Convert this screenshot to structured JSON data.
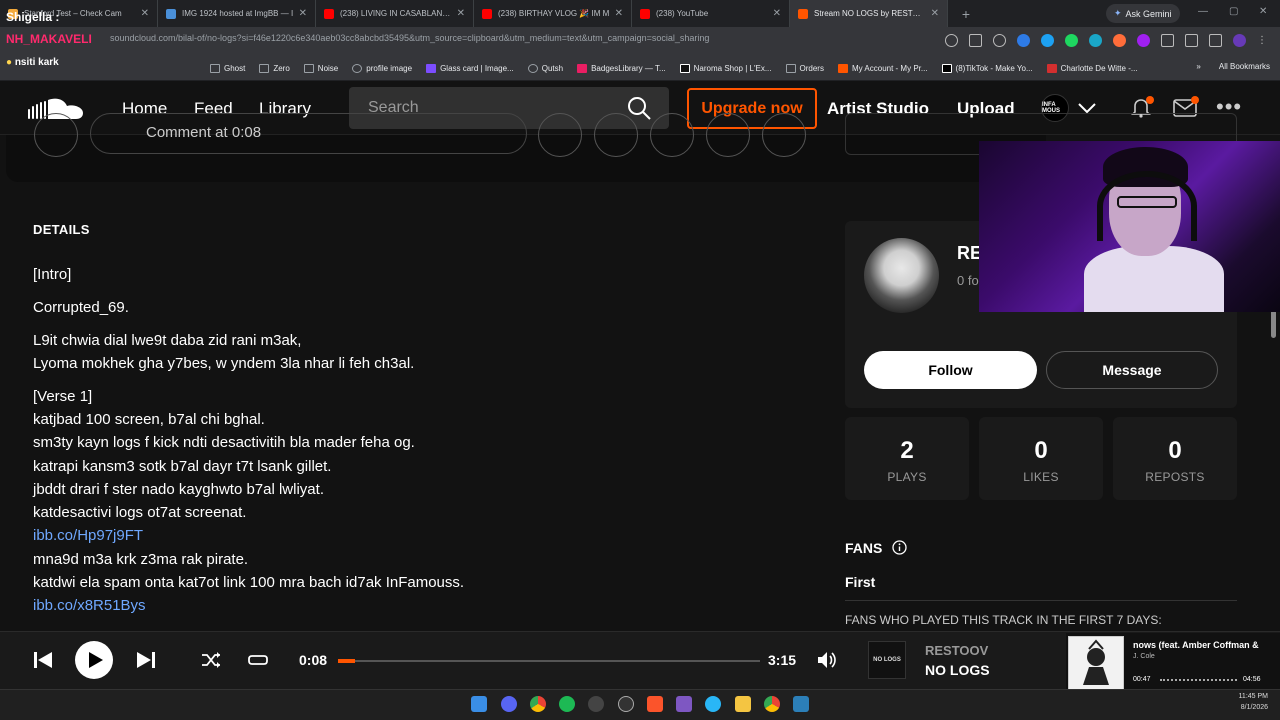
{
  "browser": {
    "tabs": [
      {
        "title": "Stanford Test – Check Cam",
        "color": "#f2a93b"
      },
      {
        "title": "IMG 1924 hosted at ImgBB — I",
        "color": "#4a90d9"
      },
      {
        "title": "(238) LIVING IN CASABLANCA",
        "color": "#ff0000"
      },
      {
        "title": "(238) BIRTHAY VLOG 🎉 IM M",
        "color": "#ff0000"
      },
      {
        "title": "(238) YouTube",
        "color": "#ff0000"
      },
      {
        "title": "Stream NO LOGS by RESTOOV",
        "color": "#ff5500"
      }
    ],
    "ask_gemini": "Ask Gemini",
    "url": "soundcloud.com/bilal-of/no-logs?si=f46e1220c6e340aeb03cc8abcbd35495&utm_source=clipboard&utm_medium=text&utm_campaign=social_sharing",
    "bookmarks": [
      "Ghost",
      "Zero",
      "Noise",
      "profile image",
      "Glass card | Image...",
      "Qutsh",
      "BadgesLibrary — T...",
      "Naroma Shop | L'Ex...",
      "Orders",
      "My Account - My Pr...",
      "(8)TikTok - Make Yo...",
      "Charlotte De Witte -..."
    ],
    "all_bookmarks": "All Bookmarks"
  },
  "overlay": {
    "streamer": "Shigella :",
    "nh": "NH_MAKAVELI",
    "red": "nsiti kark"
  },
  "header": {
    "nav": [
      "Home",
      "Feed",
      "Library"
    ],
    "search_placeholder": "Search",
    "upgrade": "Upgrade now",
    "artist_studio": "Artist Studio",
    "upload": "Upload",
    "avatar_text": "INFA MOUS"
  },
  "comment": {
    "placeholder": "Comment at 0:08"
  },
  "details": {
    "heading": "DETAILS",
    "lines": [
      {
        "text": "[Intro]",
        "link": false
      },
      {
        "text": "Corrupted_69.",
        "link": false
      },
      {
        "text": "L9it chwia dial lwe9t daba zid rani m3ak,",
        "link": false
      },
      {
        "text": "Lyoma mokhek gha y7bes, w yndem 3la nhar li feh ch3al.",
        "link": false
      },
      {
        "text": "[Verse 1]",
        "link": false
      },
      {
        "text": "katjbad 100 screen, b7al chi bghal.",
        "link": false
      },
      {
        "text": "sm3ty kayn logs f kick ndti desactivitih bla mader feha og.",
        "link": false
      },
      {
        "text": "katrapi kansm3 sotk b7al dayr t7t lsank gillet.",
        "link": false
      },
      {
        "text": "jbddt drari f ster nado kayghwto b7al lwliyat.",
        "link": false
      },
      {
        "text": "katdesactivi logs ot7at screenat.",
        "link": false
      },
      {
        "text": "ibb.co/Hp97j9FT",
        "link": true
      },
      {
        "text": "mna9d m3a krk z3ma rak pirate.",
        "link": false
      },
      {
        "text": "katdwi ela spam onta kat7ot link 100 mra bach id7ak InFamouss.",
        "link": false
      },
      {
        "text": "ibb.co/x8R51Bys",
        "link": true
      }
    ]
  },
  "profile": {
    "name": "RE",
    "sub": "0 fo",
    "follow": "Follow",
    "message": "Message"
  },
  "stats": [
    {
      "value": "2",
      "label": "PLAYS"
    },
    {
      "value": "0",
      "label": "LIKES"
    },
    {
      "value": "0",
      "label": "REPOSTS"
    }
  ],
  "fans": {
    "heading": "FANS",
    "tab": "First",
    "subtitle": "FANS WHO PLAYED THIS TRACK IN THE FIRST 7 DAYS:"
  },
  "player": {
    "current": "0:08",
    "duration": "3:15",
    "progress": 0.041,
    "artist": "RESTOOV",
    "title": "NO LOGS",
    "cover_text": "NO LOGS"
  },
  "mini_player": {
    "title": "nows (feat. Amber Coffman &",
    "artist": "J. Cole",
    "elapsed": "00:47",
    "total": "04:56"
  },
  "taskbar": {
    "time": "11:45 PM",
    "date": "8/1/2026"
  }
}
